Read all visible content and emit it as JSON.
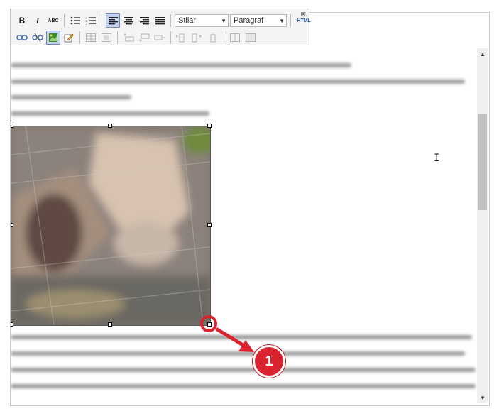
{
  "toolbar": {
    "bold": "B",
    "italic": "I",
    "strikethrough": "ABC",
    "styles_select": "Stilar",
    "paragraph_select": "Paragraf",
    "html_button": "HTML",
    "close": "⊠"
  },
  "step_badge": "1",
  "colors": {
    "accent": "#d9232e",
    "toolbar_active": "#c5d4ec"
  }
}
